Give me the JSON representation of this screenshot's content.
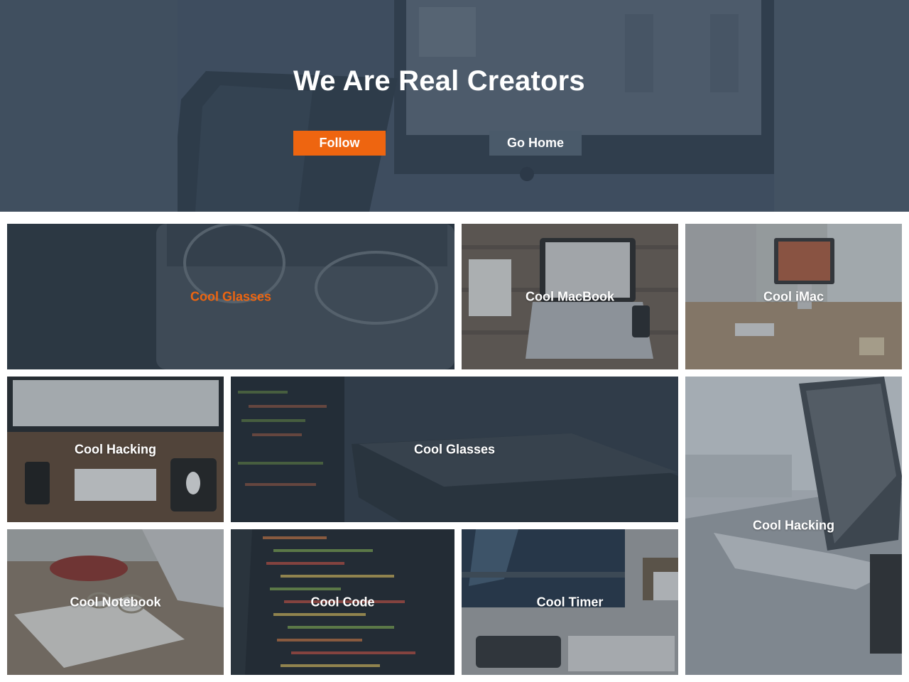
{
  "hero": {
    "title": "We Are Real Creators",
    "follow_label": "Follow",
    "home_label": "Go Home"
  },
  "tiles": [
    {
      "label": "Cool Glasses",
      "highlighted": true
    },
    {
      "label": "Cool MacBook"
    },
    {
      "label": "Cool iMac"
    },
    {
      "label": "Cool Hacking"
    },
    {
      "label": "Cool Glasses"
    },
    {
      "label": "Cool Hacking"
    },
    {
      "label": "Cool Notebook"
    },
    {
      "label": "Cool Code"
    },
    {
      "label": "Cool Timer"
    }
  ],
  "colors": {
    "accent": "#ee6510",
    "hero_overlay": "#3d4c5c",
    "secondary_button": "#4a5a6a"
  }
}
